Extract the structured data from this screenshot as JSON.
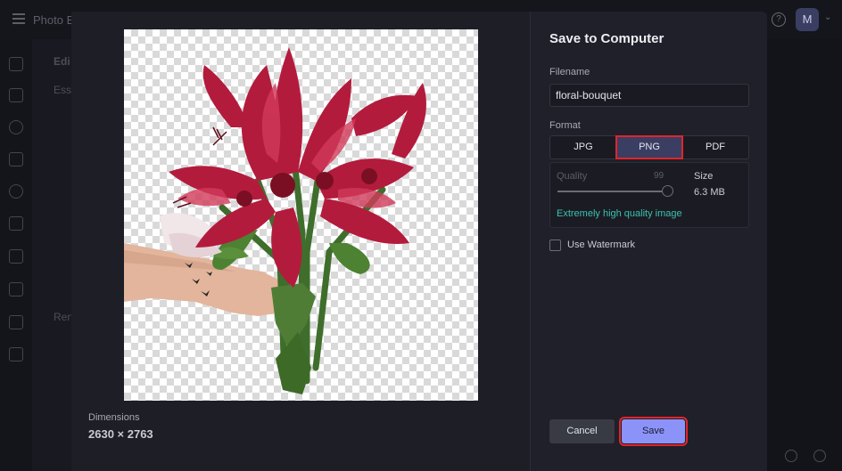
{
  "app": {
    "title": "Photo E",
    "user_initial": "M",
    "panel_labels": [
      "Edi",
      "Ess",
      "Ren"
    ]
  },
  "modal": {
    "title": "Save to Computer",
    "filename_label": "Filename",
    "filename_value": "floral-bouquet",
    "format_label": "Format",
    "formats": [
      "JPG",
      "PNG",
      "PDF"
    ],
    "selected_format": "PNG",
    "quality_label": "Quality",
    "quality_value": "99",
    "quality_level": 0.99,
    "size_label": "Size",
    "size_value": "6.3 MB",
    "quality_note": "Extremely high quality image",
    "watermark_label": "Use Watermark",
    "watermark_checked": false,
    "dimensions_label": "Dimensions",
    "dimensions_value": "2630 × 2763",
    "cancel_label": "Cancel",
    "save_label": "Save",
    "accent_color": "#8c93f8",
    "highlight_color": "#e2242a",
    "note_color": "#3bc0b2"
  }
}
